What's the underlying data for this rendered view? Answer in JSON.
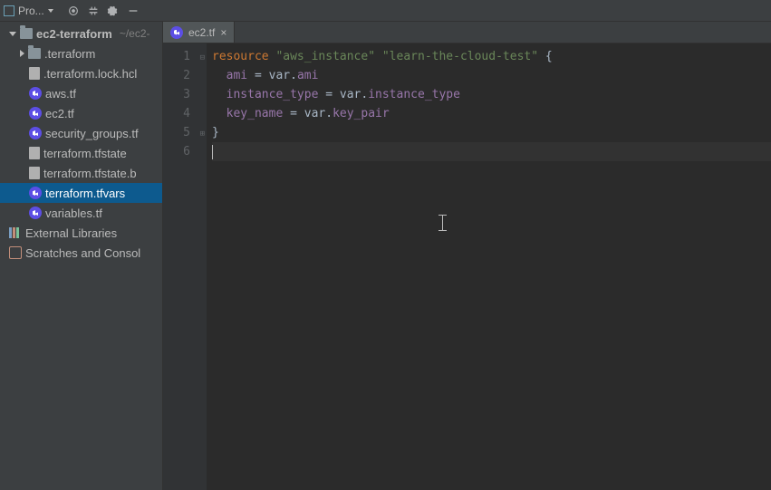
{
  "toolbar": {
    "project_label": "Pro..."
  },
  "tree": {
    "root": {
      "label": "ec2-terraform",
      "path": "~/ec2-"
    },
    "items": [
      {
        "label": ".terraform"
      },
      {
        "label": ".terraform.lock.hcl"
      },
      {
        "label": "aws.tf"
      },
      {
        "label": "ec2.tf"
      },
      {
        "label": "security_groups.tf"
      },
      {
        "label": "terraform.tfstate"
      },
      {
        "label": "terraform.tfstate.b"
      },
      {
        "label": "terraform.tfvars"
      },
      {
        "label": "variables.tf"
      }
    ],
    "external_libs": "External Libraries",
    "scratches": "Scratches and Consol"
  },
  "editor": {
    "tab": {
      "label": "ec2.tf"
    },
    "line_numbers": [
      "1",
      "2",
      "3",
      "4",
      "5",
      "6"
    ],
    "code": {
      "l1": {
        "kw": "resource",
        "s1": "\"aws_instance\"",
        "s2": "\"learn-the-cloud-test\"",
        "brace": "{"
      },
      "l2": {
        "prop": "ami",
        "eq": " = ",
        "var": "var.",
        "attr": "ami"
      },
      "l3": {
        "prop": "instance_type",
        "eq": " = ",
        "var": "var.",
        "attr": "instance_type"
      },
      "l4": {
        "prop": "key_name",
        "eq": " = ",
        "var": "var.",
        "attr": "key_pair"
      },
      "l5": {
        "brace": "}"
      }
    }
  }
}
